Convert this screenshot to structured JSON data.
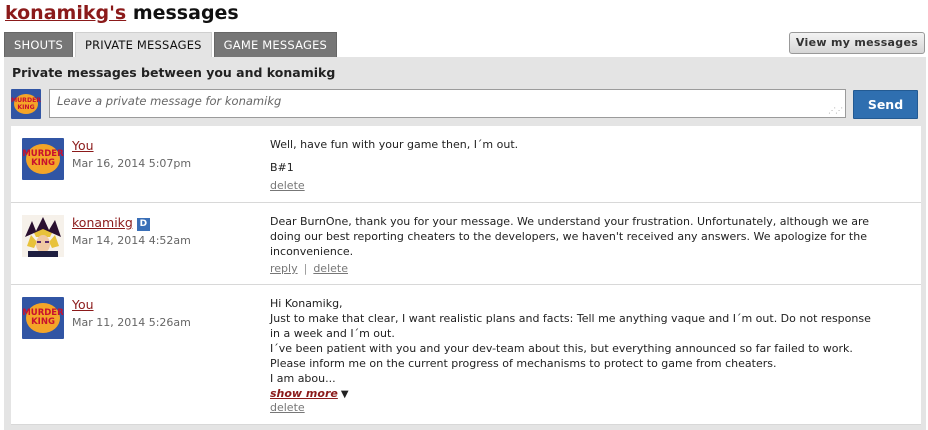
{
  "header": {
    "username": "konamikg's",
    "title_suffix": " messages"
  },
  "tabs": [
    {
      "label": "SHOUTS"
    },
    {
      "label": "PRIVATE MESSAGES"
    },
    {
      "label": "GAME MESSAGES"
    }
  ],
  "view_button": "View my messages",
  "panel_title": "Private messages between you and konamikg",
  "avatar_text": {
    "line1": "MURDER",
    "line2": "KING"
  },
  "compose": {
    "placeholder": "Leave a private message for konamikg",
    "send_label": "Send"
  },
  "messages": [
    {
      "author": "You",
      "date": "Mar 16, 2014 5:07pm",
      "lines": [
        "Well, have fun with your game then, I´m out.",
        "",
        "B#1"
      ],
      "delete_label": "delete"
    },
    {
      "author": "konamikg",
      "badge": "D",
      "date": "Mar 14, 2014 4:52am",
      "lines": [
        "Dear BurnOne, thank you for your message. We understand your frustration. Unfortunately, although we are",
        "doing our best reporting cheaters to the developers, we haven't received any answers. We apologize for the",
        "inconvenience."
      ],
      "reply_label": "reply",
      "delete_label": "delete"
    },
    {
      "author": "You",
      "date": "Mar 11, 2014 5:26am",
      "lines": [
        "Hi Konamikg,",
        "Just to make that clear, I want realistic plans and facts: Tell me anything vaque and I´m out. Do not response",
        "in a week and I´m out.",
        "I´ve been patient with you and your dev-team about this, but everything announced so far failed to work.",
        "Please inform me on the current progress of mechanisms to protect to game from cheaters.",
        "I am abou..."
      ],
      "show_more_label": "show more",
      "delete_label": "delete"
    }
  ]
}
